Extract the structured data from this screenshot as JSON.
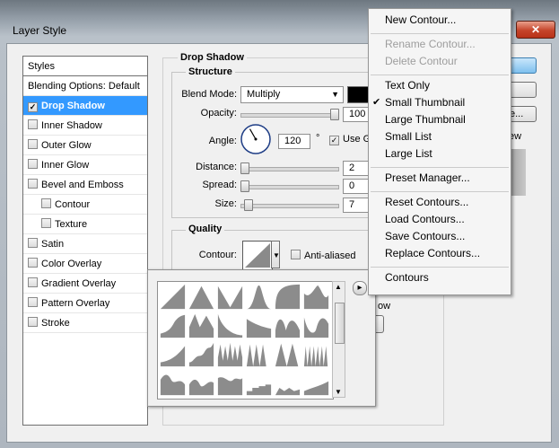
{
  "window": {
    "title": "Layer Style",
    "close_glyph": "✕"
  },
  "styles": {
    "header": "Styles",
    "items": [
      {
        "label": "Blending Options: Default",
        "checkbox": false,
        "checked": false,
        "indent": false,
        "selected": false
      },
      {
        "label": "Drop Shadow",
        "checkbox": true,
        "checked": true,
        "indent": false,
        "selected": true
      },
      {
        "label": "Inner Shadow",
        "checkbox": true,
        "checked": false,
        "indent": false,
        "selected": false
      },
      {
        "label": "Outer Glow",
        "checkbox": true,
        "checked": false,
        "indent": false,
        "selected": false
      },
      {
        "label": "Inner Glow",
        "checkbox": true,
        "checked": false,
        "indent": false,
        "selected": false
      },
      {
        "label": "Bevel and Emboss",
        "checkbox": true,
        "checked": false,
        "indent": false,
        "selected": false
      },
      {
        "label": "Contour",
        "checkbox": true,
        "checked": false,
        "indent": true,
        "selected": false
      },
      {
        "label": "Texture",
        "checkbox": true,
        "checked": false,
        "indent": true,
        "selected": false
      },
      {
        "label": "Satin",
        "checkbox": true,
        "checked": false,
        "indent": false,
        "selected": false
      },
      {
        "label": "Color Overlay",
        "checkbox": true,
        "checked": false,
        "indent": false,
        "selected": false
      },
      {
        "label": "Gradient Overlay",
        "checkbox": true,
        "checked": false,
        "indent": false,
        "selected": false
      },
      {
        "label": "Pattern Overlay",
        "checkbox": true,
        "checked": false,
        "indent": false,
        "selected": false
      },
      {
        "label": "Stroke",
        "checkbox": true,
        "checked": false,
        "indent": false,
        "selected": false
      }
    ]
  },
  "drop_shadow": {
    "title": "Drop Shadow",
    "structure_title": "Structure",
    "blend_mode_label": "Blend Mode:",
    "blend_mode_value": "Multiply",
    "shadow_color": "#000000",
    "opacity_label": "Opacity:",
    "opacity_value": "100",
    "opacity_level": 1.0,
    "angle_label": "Angle:",
    "angle_value": "120",
    "angle_unit": "°",
    "use_global_label": "Use G",
    "use_global_checked": true,
    "distance_label": "Distance:",
    "distance_value": "2",
    "distance_level": 0.0,
    "spread_label": "Spread:",
    "spread_value": "0",
    "spread_level": 0.0,
    "size_label": "Size:",
    "size_value": "7",
    "size_level": 0.04,
    "quality_title": "Quality",
    "contour_label": "Contour:",
    "anti_aliased_label": "Anti-aliased",
    "partial_text": "ow"
  },
  "right_buttons": {
    "partial_new_style": "e..."
  },
  "partial_preview_label": "ew",
  "contour_menu": {
    "items": [
      {
        "label": "New Contour...",
        "disabled": false,
        "checked": false
      },
      {
        "separator": true
      },
      {
        "label": "Rename Contour...",
        "disabled": true,
        "checked": false
      },
      {
        "label": "Delete Contour",
        "disabled": true,
        "checked": false
      },
      {
        "separator": true
      },
      {
        "label": "Text Only",
        "disabled": false,
        "checked": false
      },
      {
        "label": "Small Thumbnail",
        "disabled": false,
        "checked": true
      },
      {
        "label": "Large Thumbnail",
        "disabled": false,
        "checked": false
      },
      {
        "label": "Small List",
        "disabled": false,
        "checked": false
      },
      {
        "label": "Large List",
        "disabled": false,
        "checked": false
      },
      {
        "separator": true
      },
      {
        "label": "Preset Manager...",
        "disabled": false,
        "checked": false
      },
      {
        "separator": true
      },
      {
        "label": "Reset Contours...",
        "disabled": false,
        "checked": false
      },
      {
        "label": "Load Contours...",
        "disabled": false,
        "checked": false
      },
      {
        "label": "Save Contours...",
        "disabled": false,
        "checked": false
      },
      {
        "label": "Replace Contours...",
        "disabled": false,
        "checked": false
      },
      {
        "separator": true
      },
      {
        "label": "Contours",
        "disabled": false,
        "checked": false
      }
    ],
    "check_glyph": "✔"
  },
  "contour_picker": {
    "menu_arrow_glyph": "▸",
    "presets": [
      "linear",
      "cone",
      "cone-inverted",
      "gaussian",
      "half-round",
      "ring",
      "rolling-slope",
      "sawtooth",
      "cove-deep",
      "cove-shallow",
      "ring-double",
      "ring-triple",
      "shallow-slope",
      "round-steps",
      "ring-spikes",
      "peaks-triple",
      "peaks-double",
      "peaks-many",
      "rolling-hills",
      "waves",
      "ridge",
      "steps",
      "ring-small",
      "rolling",
      "pulses",
      "slope-bumps",
      "jagged",
      "valleys"
    ]
  },
  "colors": {
    "selection": "#3399ff",
    "accent_button": "#4fa6e0"
  }
}
